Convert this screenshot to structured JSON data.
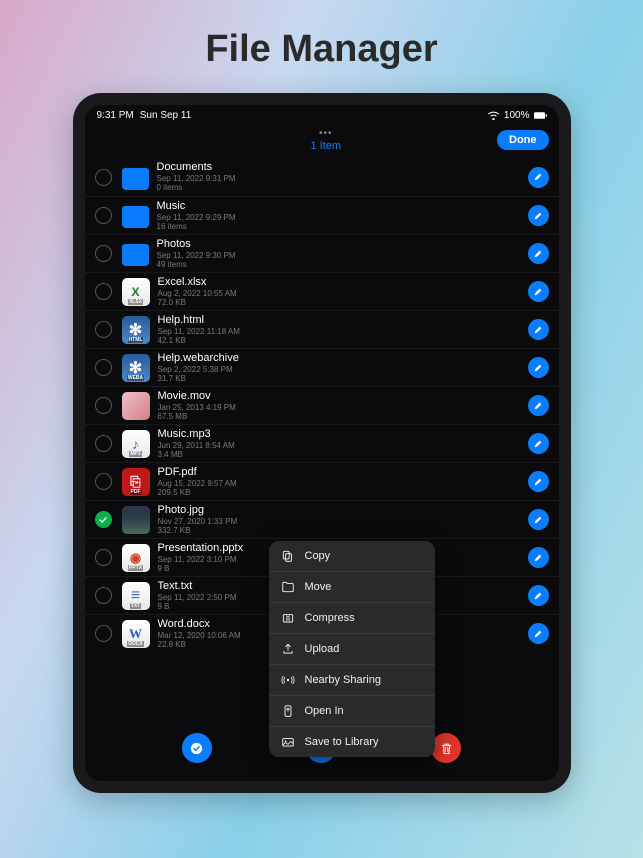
{
  "promo": {
    "title": "File Manager"
  },
  "status": {
    "time": "9:31 PM",
    "date": "Sun Sep 11",
    "battery": "100%"
  },
  "nav": {
    "item_count": "1 Item",
    "done_label": "Done"
  },
  "files": [
    {
      "name": "Documents",
      "date": "Sep 11, 2022 9:31 PM",
      "size": "0 items",
      "type": "folder",
      "selected": false
    },
    {
      "name": "Music",
      "date": "Sep 11, 2022 9:29 PM",
      "size": "16 items",
      "type": "folder",
      "selected": false
    },
    {
      "name": "Photos",
      "date": "Sep 11, 2022 9:30 PM",
      "size": "49 items",
      "type": "folder",
      "selected": false
    },
    {
      "name": "Excel.xlsx",
      "date": "Aug 2, 2022 10:55 AM",
      "size": "72.0 KB",
      "type": "xlsx",
      "ext": "XLSX",
      "selected": false
    },
    {
      "name": "Help.html",
      "date": "Sep 11, 2022 11:18 AM",
      "size": "42.1 KB",
      "type": "html",
      "ext": "HTML",
      "selected": false
    },
    {
      "name": "Help.webarchive",
      "date": "Sep 2, 2022 5:38 PM",
      "size": "31.7 KB",
      "type": "weba",
      "ext": "WEBA",
      "selected": false
    },
    {
      "name": "Movie.mov",
      "date": "Jan 25, 2013 4:19 PM",
      "size": "67.5 MB",
      "type": "movie",
      "selected": false
    },
    {
      "name": "Music.mp3",
      "date": "Jun 29, 2011 8:54 AM",
      "size": "3.4 MB",
      "type": "mp3",
      "ext": "MP3",
      "selected": false
    },
    {
      "name": "PDF.pdf",
      "date": "Aug 15, 2022 9:57 AM",
      "size": "209.5 KB",
      "type": "pdf",
      "ext": "PDF",
      "selected": false
    },
    {
      "name": "Photo.jpg",
      "date": "Nov 27, 2020 1:33 PM",
      "size": "332.7 KB",
      "type": "photo",
      "selected": true
    },
    {
      "name": "Presentation.pptx",
      "date": "Sep 11, 2022 3:10 PM",
      "size": "9 B",
      "type": "pptx",
      "ext": "PPTX",
      "selected": false
    },
    {
      "name": "Text.txt",
      "date": "Sep 11, 2022 2:50 PM",
      "size": "9 B",
      "type": "txt",
      "ext": "TXT",
      "selected": false
    },
    {
      "name": "Word.docx",
      "date": "Mar 12, 2020 10:06 AM",
      "size": "22.8 KB",
      "type": "docx",
      "ext": "DOCX",
      "selected": false
    }
  ],
  "menu": {
    "items": [
      {
        "label": "Copy",
        "icon": "copy"
      },
      {
        "label": "Move",
        "icon": "move"
      },
      {
        "label": "Compress",
        "icon": "compress"
      },
      {
        "label": "Upload",
        "icon": "upload"
      },
      {
        "label": "Nearby Sharing",
        "icon": "nearby"
      },
      {
        "label": "Open In",
        "icon": "open-in"
      },
      {
        "label": "Save to Library",
        "icon": "save-library"
      }
    ]
  }
}
